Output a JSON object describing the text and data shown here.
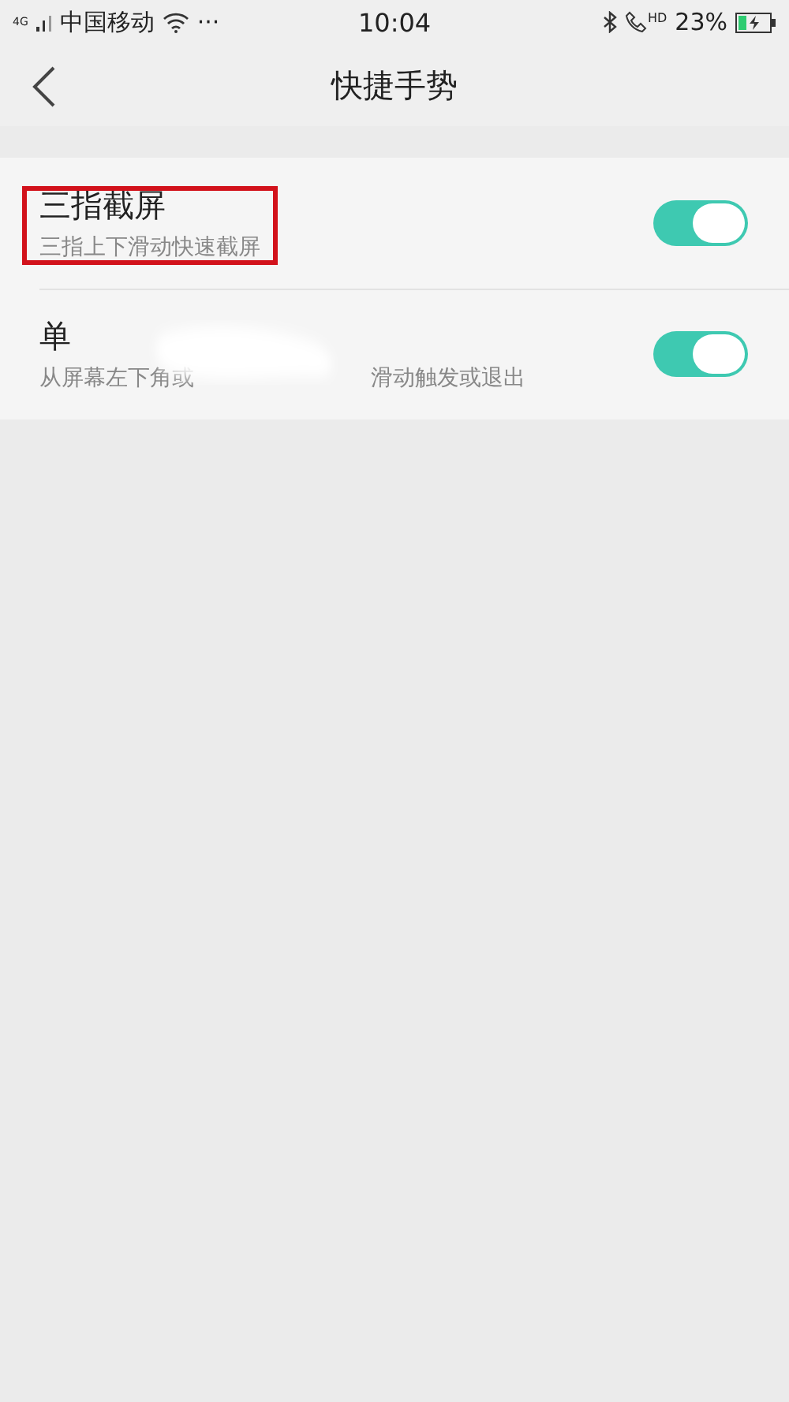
{
  "status_bar": {
    "network": "4G",
    "carrier": "中国移动",
    "more": "···",
    "time": "10:04",
    "hd": "HD",
    "battery": "23%"
  },
  "header": {
    "title": "快捷手势"
  },
  "settings": [
    {
      "title": [
        "三指截屏"
      ],
      "subtitle": [
        "三指上下滑动快速截屏"
      ],
      "on": true,
      "highlighted": true,
      "smudged": false
    },
    {
      "title": [
        "单"
      ],
      "subtitle": [
        "从屏幕左下角或",
        "滑动触发或退出"
      ],
      "on": true,
      "highlighted": false,
      "smudged": true
    }
  ]
}
